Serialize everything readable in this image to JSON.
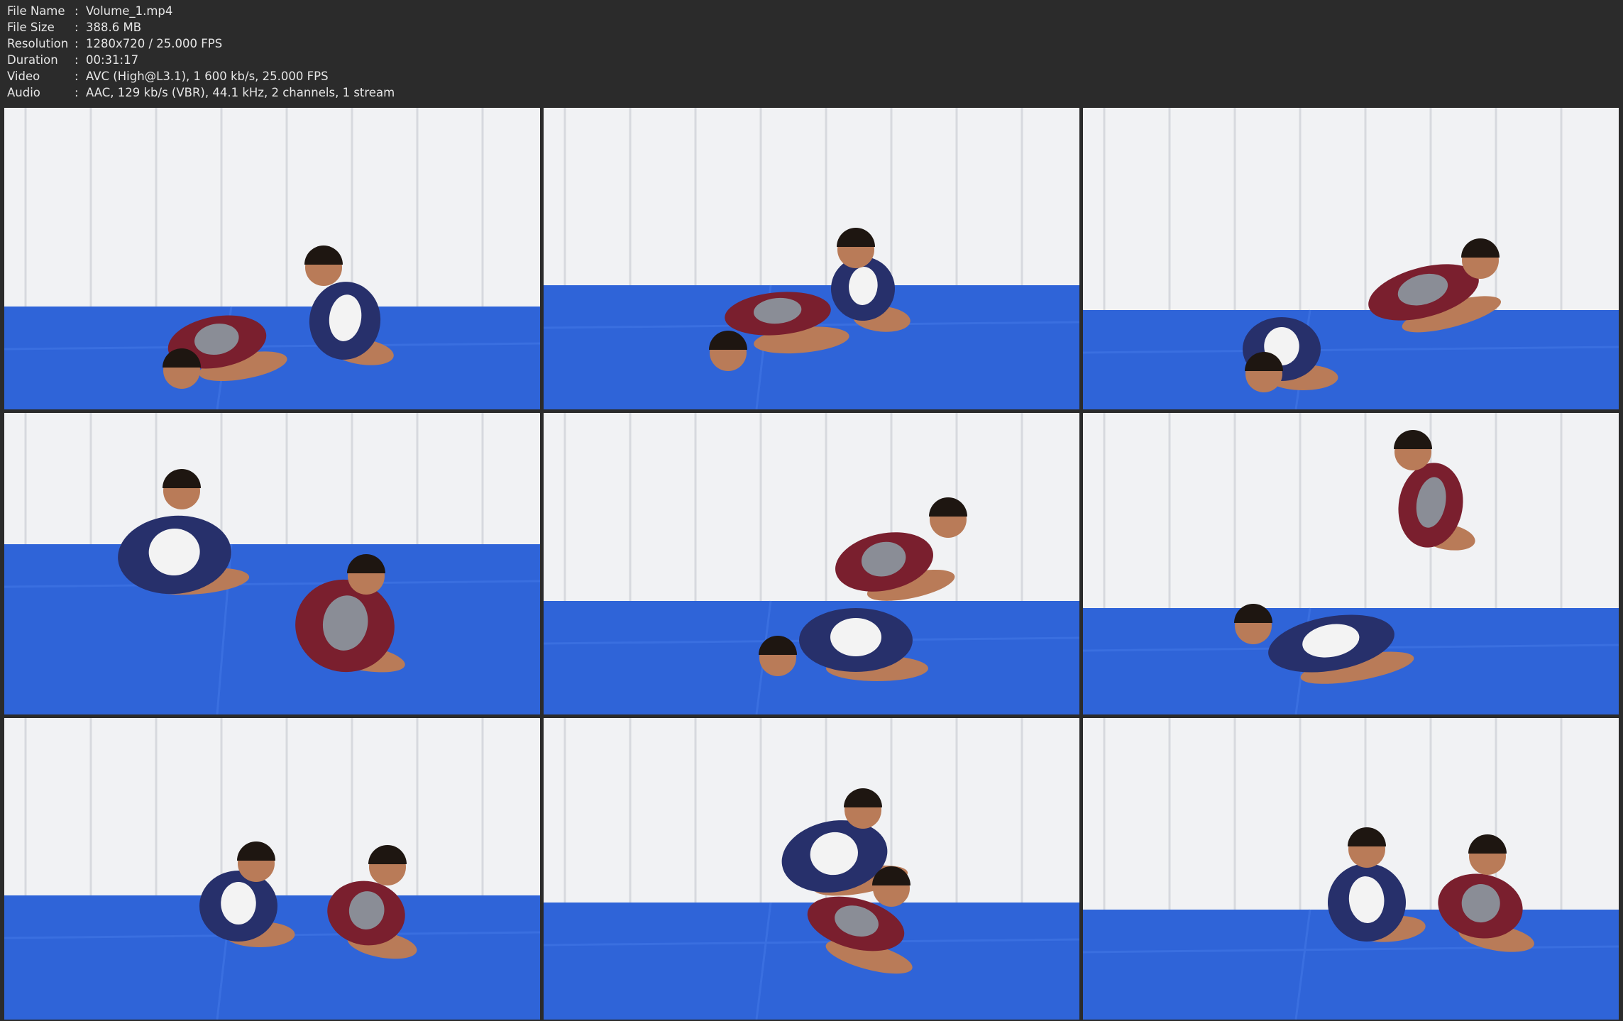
{
  "info": [
    {
      "label": "File Name",
      "value": "Volume_1.mp4"
    },
    {
      "label": "File Size",
      "value": "388.6 MB"
    },
    {
      "label": "Resolution",
      "value": "1280x720 / 25.000 FPS"
    },
    {
      "label": "Duration",
      "value": "00:31:17"
    },
    {
      "label": "Video",
      "value": "AVC (High@L3.1), 1 600 kb/s, 25.000 FPS"
    },
    {
      "label": "Audio",
      "value": "AAC, 129 kb/s (VBR), 44.1 kHz, 2 channels, 1 stream"
    }
  ],
  "colors": {
    "background": "#2b2b2b",
    "info_text": "#e6e6e6",
    "wall": "#f1f2f4",
    "mat": "#2f64d8",
    "navy_rashguard": "#27306b",
    "maroon_rashguard": "#7a1f2e",
    "grey_rashguard": "#8a8d96",
    "white_rashguard": "#f3f3f3",
    "skin": "#b97b58",
    "hair": "#1e1611"
  },
  "thumbnails": [
    {
      "scene": "thumbnail-1"
    },
    {
      "scene": "thumbnail-2"
    },
    {
      "scene": "thumbnail-3"
    },
    {
      "scene": "thumbnail-4"
    },
    {
      "scene": "thumbnail-5"
    },
    {
      "scene": "thumbnail-6"
    },
    {
      "scene": "thumbnail-7"
    },
    {
      "scene": "thumbnail-8"
    },
    {
      "scene": "thumbnail-9"
    }
  ]
}
